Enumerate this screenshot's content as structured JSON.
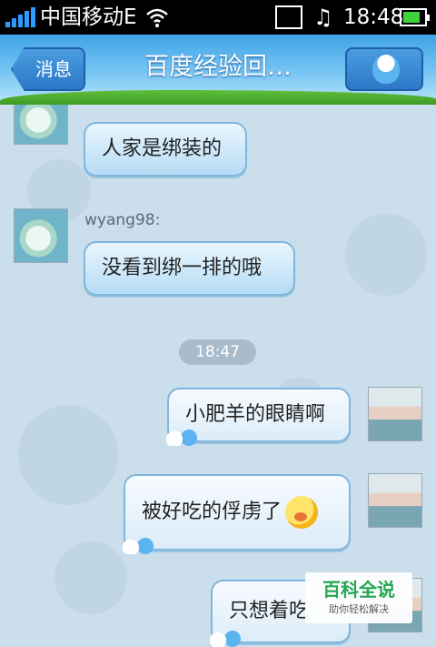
{
  "status_bar": {
    "carrier": "中国移动E",
    "time": "18:48"
  },
  "header": {
    "back_label": "消息",
    "title": "百度经验回…"
  },
  "messages": [
    {
      "side": "left",
      "sender": "wyang98:",
      "text": "人家是绑装的"
    },
    {
      "side": "left",
      "sender": "wyang98:",
      "text": "没看到绑一排的哦"
    },
    {
      "type": "time",
      "text": "18:47"
    },
    {
      "side": "right",
      "text": "小肥羊的眼睛啊"
    },
    {
      "side": "right",
      "text": "被好吃的俘虏了",
      "emoji": "drooling-emoji"
    },
    {
      "side": "right",
      "text": "只想着吃"
    }
  ],
  "watermark": {
    "title": "百科全说",
    "subtitle": "助你轻松解决"
  },
  "icons": [
    "signal-icon",
    "wifi-icon",
    "gallery-icon",
    "music-icon",
    "battery-icon",
    "smurf-avatar-icon"
  ],
  "colors": {
    "status_bg": "#000000",
    "header_blue": "#3fa3e6",
    "chat_bg": "#cadeec",
    "bubble_border": "#7fb6dc",
    "battery_green": "#3fd23f"
  }
}
